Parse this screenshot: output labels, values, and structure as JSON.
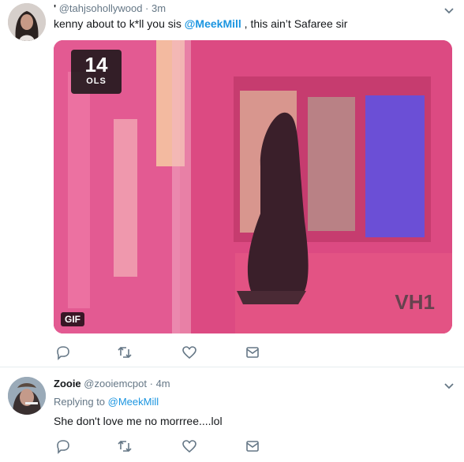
{
  "tweet1": {
    "display_name": "'",
    "handle": "@tahjsohollywood",
    "separator": "·",
    "time": "3m",
    "text_before": "kenny about to k*ll you sis ",
    "mention": "@MeekMill",
    "text_after": " , this ain’t Safaree sir",
    "media": {
      "badge": "GIF",
      "channel_number": "14",
      "channel_sub": "OLS",
      "watermark": "VH1"
    },
    "icons": [
      "reply-icon",
      "retweet-icon",
      "like-icon",
      "message-icon",
      "chevron-down-icon"
    ]
  },
  "tweet2": {
    "display_name": "Zooie",
    "handle": "@zooiemcpot",
    "separator": "·",
    "time": "4m",
    "replying_label": "Replying to ",
    "replying_mention": "@MeekMill",
    "text": "She don't love me no morrree....lol",
    "icons": [
      "reply-icon",
      "retweet-icon",
      "like-icon",
      "message-icon",
      "chevron-down-icon"
    ]
  },
  "colors": {
    "link": "#1b95e0",
    "secondary_text": "#657786",
    "primary_text": "#14171a",
    "media_pink": "#e0457f"
  }
}
